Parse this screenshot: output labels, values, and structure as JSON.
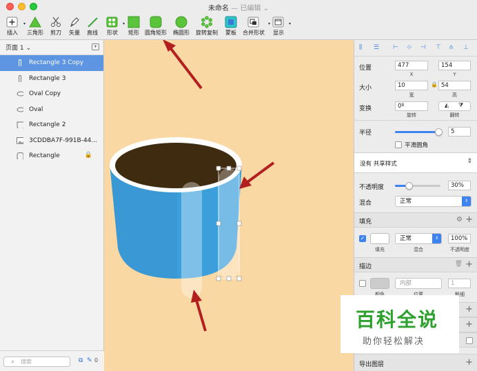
{
  "window": {
    "title": "未命名",
    "edited": "— 已编辑 ⌄"
  },
  "toolbar": {
    "items": [
      {
        "label": "插入"
      },
      {
        "label": "三角形"
      },
      {
        "label": "剪刀"
      },
      {
        "label": "矢量"
      },
      {
        "label": "直线"
      },
      {
        "label": "形状"
      },
      {
        "label": "矩形"
      },
      {
        "label": "圆角矩形"
      },
      {
        "label": "椭圆形"
      },
      {
        "label": "旋转复制"
      },
      {
        "label": "蒙板"
      },
      {
        "label": "合并形状"
      },
      {
        "label": "显示"
      }
    ]
  },
  "layers": {
    "page_label": "页面 1 ⌄",
    "items": [
      {
        "name": "Rectangle 3 Copy",
        "icon": "thin-rect-icon",
        "selected": true
      },
      {
        "name": "Rectangle 3",
        "icon": "thin-rect-icon"
      },
      {
        "name": "Oval Copy",
        "icon": "oval-icon"
      },
      {
        "name": "Oval",
        "icon": "oval-icon"
      },
      {
        "name": "Rectangle 2",
        "icon": "cup-shape-icon"
      },
      {
        "name": "3CDDBA7F-991B-44...",
        "icon": "image-icon"
      },
      {
        "name": "Rectangle",
        "icon": "rounded-rect-icon",
        "locked": true
      }
    ],
    "search_placeholder": "搜索",
    "badge_count": "0"
  },
  "inspector": {
    "position_label": "位置",
    "x_value": "477",
    "y_value": "154",
    "x_caption": "X",
    "y_caption": "Y",
    "size_label": "大小",
    "width_value": "10",
    "height_value": "54",
    "width_caption": "宽",
    "height_caption": "高",
    "transform_label": "变换",
    "rotate_value": "0º",
    "rotate_caption": "旋转",
    "flip_caption": "翻转",
    "radius_label": "半径",
    "radius_value": "5",
    "radius_slider": 0.95,
    "smooth_corners_label": "平滑圆角",
    "shared_style": "没有 共享样式",
    "opacity_label": "不透明度",
    "opacity_value": "30%",
    "opacity_slider": 0.3,
    "blend_label": "混合",
    "blend_value": "正常",
    "fill_section": "填充",
    "fill_blend_value": "正常",
    "fill_opacity_value": "100%",
    "fill_caption": "填充",
    "fill_blend_caption": "混合",
    "fill_opacity_caption": "不透明度",
    "border_section": "描边",
    "border_position_value": "内部",
    "border_width_value": "1",
    "border_color_caption": "颜色",
    "border_position_caption": "位置",
    "border_width_caption": "粗细",
    "export_label": "导出图层"
  },
  "watermark": {
    "main": "百科全说",
    "sub": "助你轻松解决"
  },
  "colors": {
    "canvas": "#fad8a4",
    "cup_blue": "#3b9fdc",
    "coffee": "#3f2b10",
    "selection": "#5e95e2",
    "arrow": "#b31f1f",
    "accent": "#3d83f0"
  }
}
